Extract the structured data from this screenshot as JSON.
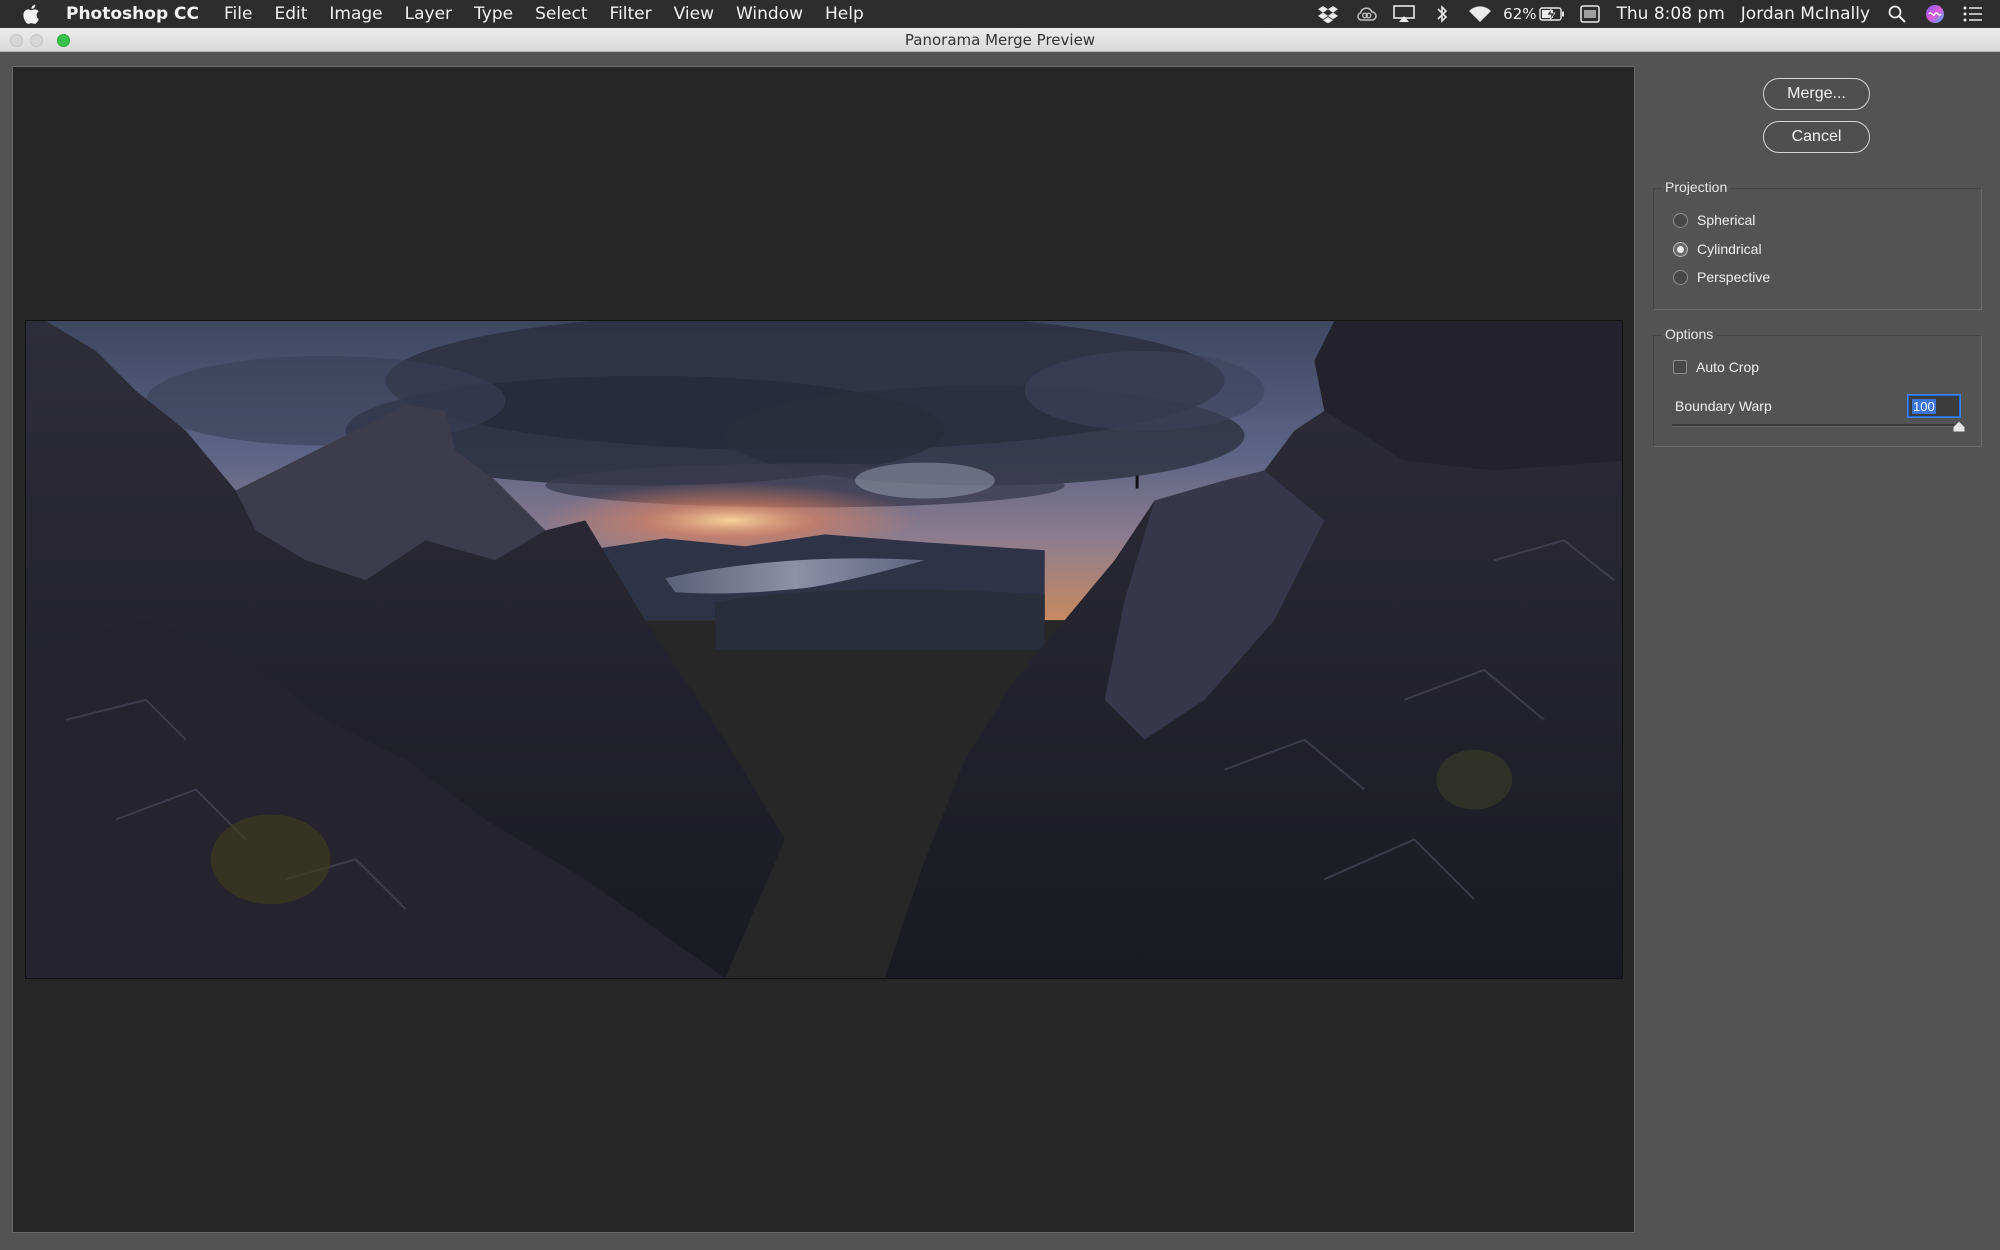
{
  "menubar": {
    "app_name": "Photoshop CC",
    "items": [
      "File",
      "Edit",
      "Image",
      "Layer",
      "Type",
      "Select",
      "Filter",
      "View",
      "Window",
      "Help"
    ],
    "battery": "62%",
    "clock": "Thu 8:08 pm",
    "user": "Jordan McInally",
    "status_icons": [
      "dropbox-icon",
      "creative-cloud-icon",
      "airplay-icon",
      "bluetooth-icon",
      "wifi-icon",
      "battery-icon",
      "keyboard-icon",
      "spotlight-search-icon",
      "siri-icon",
      "notification-center-icon"
    ]
  },
  "window": {
    "title": "Panorama Merge Preview"
  },
  "buttons": {
    "merge": "Merge...",
    "cancel": "Cancel"
  },
  "projection": {
    "label": "Projection",
    "options": [
      {
        "label": "Spherical",
        "selected": false
      },
      {
        "label": "Cylindrical",
        "selected": true
      },
      {
        "label": "Perspective",
        "selected": false
      }
    ]
  },
  "options": {
    "label": "Options",
    "auto_crop": {
      "label": "Auto Crop",
      "checked": false
    },
    "boundary_warp": {
      "label": "Boundary Warp",
      "value": "100",
      "level_percent": 100
    }
  },
  "colors": {
    "panel_bg": "#535353",
    "preview_bg": "#272727",
    "selection_blue": "#3a74d8",
    "zoom_green": "#36c14a"
  }
}
